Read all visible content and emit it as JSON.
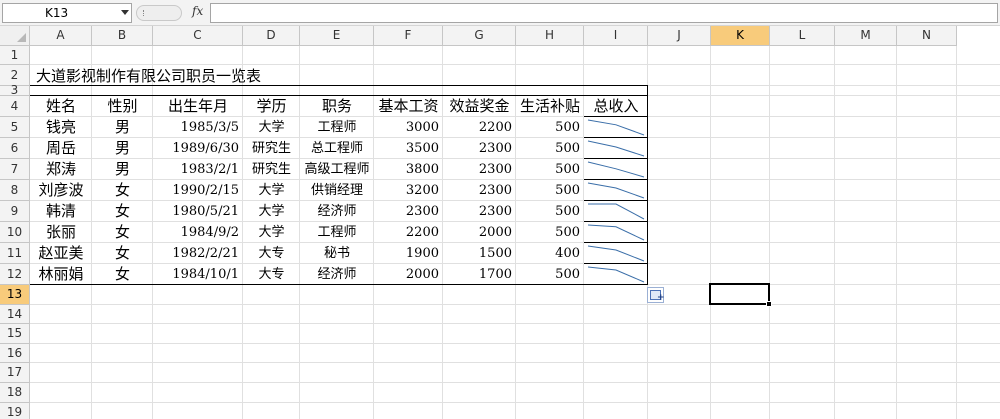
{
  "formula_bar": {
    "name_box": "K13",
    "fx_label": "fx",
    "formula": ""
  },
  "columns": [
    "A",
    "B",
    "C",
    "D",
    "E",
    "F",
    "G",
    "H",
    "I",
    "J",
    "K",
    "L",
    "M",
    "N"
  ],
  "rows": [
    "1",
    "2",
    "3",
    "4",
    "5",
    "6",
    "7",
    "8",
    "9",
    "10",
    "11",
    "12",
    "13",
    "14",
    "15",
    "16",
    "17",
    "18",
    "19"
  ],
  "selected_cell": {
    "column": "K",
    "row": "13"
  },
  "sheet": {
    "title": "大道影视制作有限公司职员一览表",
    "headers": [
      "姓名",
      "性别",
      "出生年月",
      "学历",
      "职务",
      "基本工资",
      "效益奖金",
      "生活补贴",
      "总收入"
    ],
    "records": [
      [
        "钱亮",
        "男",
        "1985/3/5",
        "大学",
        "工程师",
        "3000",
        "2200",
        "500"
      ],
      [
        "周岳",
        "男",
        "1989/6/30",
        "研究生",
        "总工程师",
        "3500",
        "2300",
        "500"
      ],
      [
        "郑涛",
        "男",
        "1983/2/1",
        "研究生",
        "高级工程师",
        "3800",
        "2300",
        "500"
      ],
      [
        "刘彦波",
        "女",
        "1990/2/15",
        "大学",
        "供销经理",
        "3200",
        "2300",
        "500"
      ],
      [
        "韩清",
        "女",
        "1980/5/21",
        "大学",
        "经济师",
        "2300",
        "2300",
        "500"
      ],
      [
        "张丽",
        "女",
        "1984/9/2",
        "大学",
        "工程师",
        "2200",
        "2000",
        "500"
      ],
      [
        "赵亚美",
        "女",
        "1982/2/21",
        "大专",
        "秘书",
        "1900",
        "1500",
        "400"
      ],
      [
        "林丽娟",
        "女",
        "1984/10/1",
        "大专",
        "经济师",
        "2000",
        "1700",
        "500"
      ]
    ]
  },
  "colors": {
    "selected_header": "#f8cb7b",
    "sparkline": "#3a6ea8",
    "grid": "#e0e0e0"
  },
  "icons": {
    "autofill": "paste-options-icon",
    "name_box_dropdown": "chevron-down-icon"
  }
}
